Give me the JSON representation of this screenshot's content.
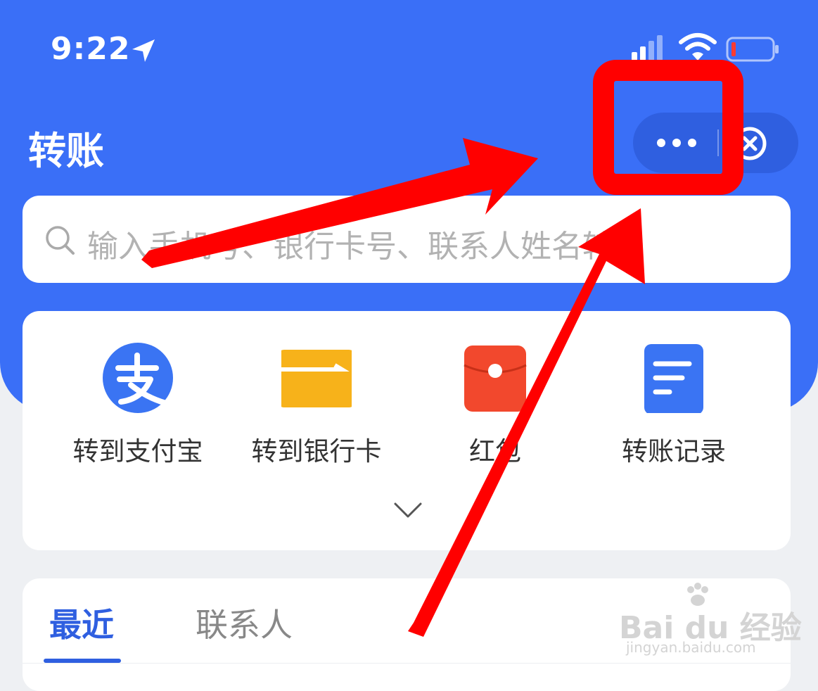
{
  "status_bar": {
    "time": "9:22",
    "icons": [
      "location-arrow-icon",
      "signal-icon",
      "wifi-icon",
      "battery-low-icon"
    ]
  },
  "header": {
    "title": "转账",
    "more_icon": "more-dots-icon",
    "close_icon": "close-circle-icon"
  },
  "search": {
    "placeholder": "输入手机号、银行卡号、联系人姓名转账",
    "icon": "search-icon"
  },
  "quick_actions": [
    {
      "label": "转到支付宝",
      "icon": "alipay-icon"
    },
    {
      "label": "转到银行卡",
      "icon": "bank-card-icon"
    },
    {
      "label": "红包",
      "icon": "red-packet-icon"
    },
    {
      "label": "转账记录",
      "icon": "record-icon"
    }
  ],
  "tabs": [
    {
      "label": "最近",
      "active": true
    },
    {
      "label": "联系人",
      "active": false
    }
  ],
  "watermark": {
    "main": "Bai du 经验",
    "url": "jingyan.baidu.com"
  },
  "colors": {
    "header_blue": "#3a6ff7",
    "tab_active": "#2f5fe0",
    "annotation_red": "#ff0000"
  }
}
